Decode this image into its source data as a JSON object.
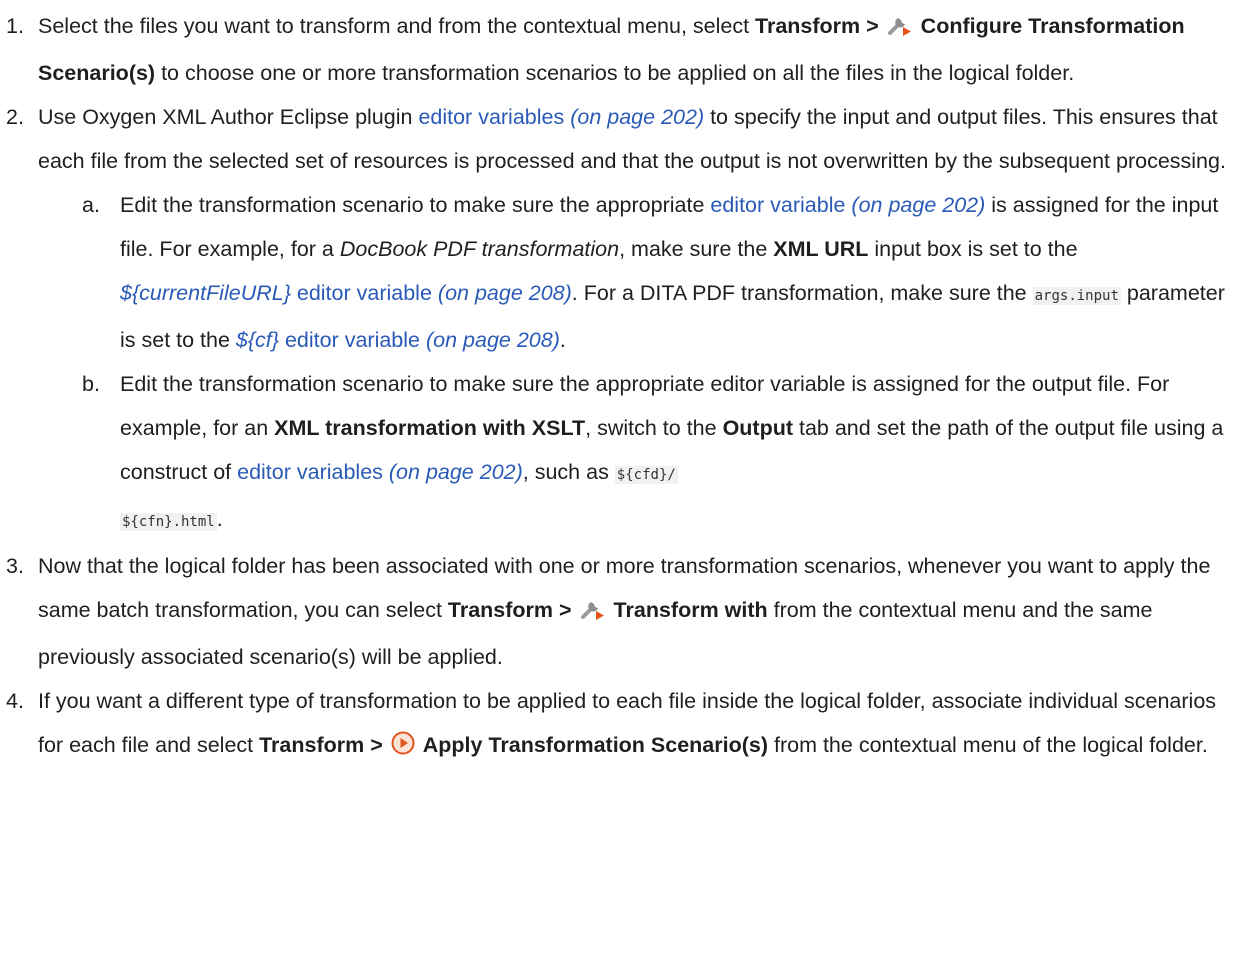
{
  "steps": [
    {
      "num": "1.",
      "t1": "Select the files you want to transform and from the contextual menu, select ",
      "menu": "Transform >",
      "icon": "wrench-arrow-icon",
      "action": "Configure Transformation Scenario(s)",
      "t2": " to choose one or more transformation scenarios to be applied on all the files in the logical folder."
    },
    {
      "num": "2.",
      "t1": "Use Oxygen XML Author Eclipse plugin ",
      "link": "editor variables",
      "page": "(on page 202)",
      "t2": " to specify the input and output files. This ensures that each file from the selected set of resources is processed and that the output is not overwritten by the subsequent processing.",
      "substeps": [
        {
          "num": "a.",
          "t1": "Edit the transformation scenario to make sure the appropriate ",
          "link1": "editor variable",
          "page1": "(on page 202)",
          "t2": " is assigned for the input file. For example, for a ",
          "ital": "DocBook PDF transformation",
          "t3": ", make sure the ",
          "bold": "XML URL",
          "t4": " input box is set to the ",
          "var1": "${currentFileURL}",
          "link2": " editor variable",
          "page2": "(on page 208)",
          "t5": ". For a DITA PDF transformation, make sure the ",
          "code": "args.input",
          "t6": " parameter is set to the ",
          "var2": "${cf}",
          "link3": " editor variable",
          "page3": "(on page 208)",
          "t7": "."
        },
        {
          "num": "b.",
          "t1": "Edit the transformation scenario to make sure the appropriate editor variable is assigned for the output file. For example, for an ",
          "bold1": "XML transformation with XSLT",
          "t2": ", switch to the ",
          "bold2": "Output",
          "t3": " tab and set the path of the output file using a construct of ",
          "link": "editor variables",
          "page": "(on page 202)",
          "t4": ", such as ",
          "code1": "${cfd}/",
          "code2": "${cfn}.html",
          "t5": "."
        }
      ]
    },
    {
      "num": "3.",
      "t1": "Now that the logical folder has been associated with one or more transformation scenarios, whenever you want to apply the same batch transformation, you can select ",
      "menu": "Transform >",
      "icon": "wrench-arrow-icon",
      "action": "Transform with",
      "t2": " from the contextual menu and the same previously associated scenario(s) will be applied."
    },
    {
      "num": "4.",
      "t1": "If you want a different type of transformation to be applied to each file inside the logical folder, associate individual scenarios for each file and select ",
      "menu": "Transform >",
      "icon": "play-circle-icon",
      "action": "Apply Transformation Scenario(s)",
      "t2": " from the contextual menu of the logical folder."
    }
  ]
}
